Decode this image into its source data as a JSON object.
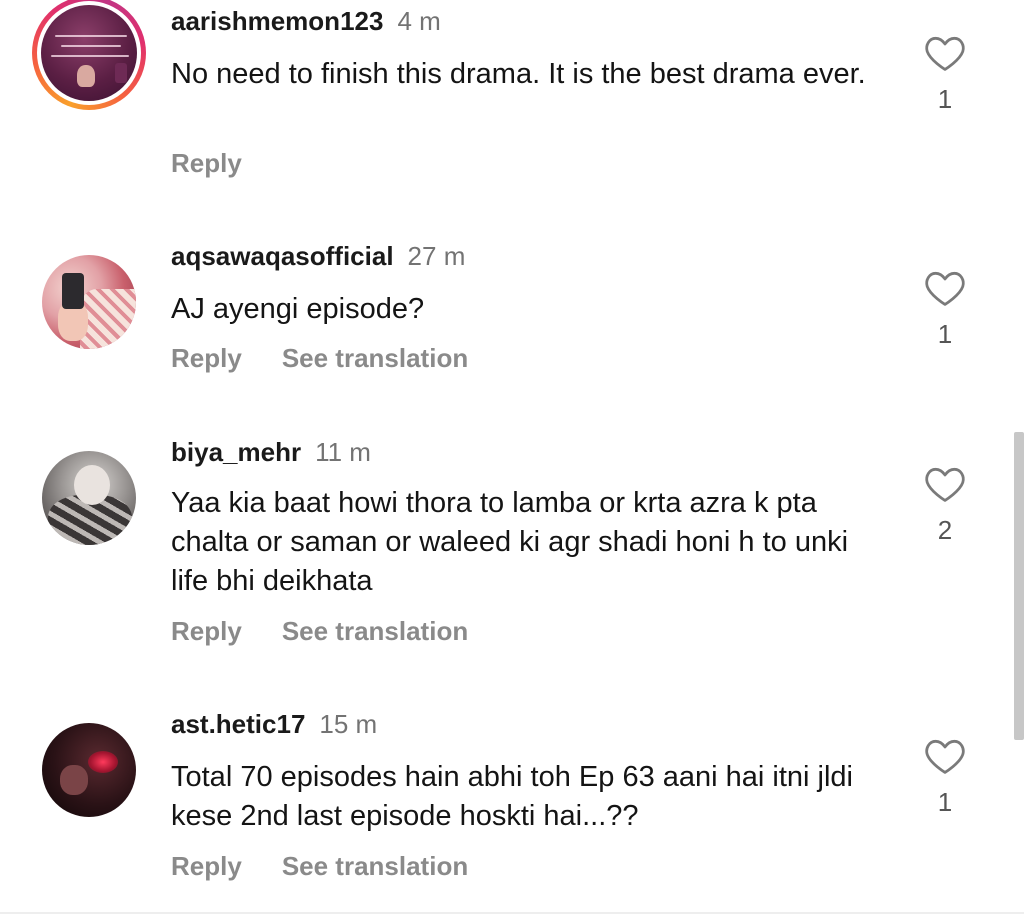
{
  "comments": [
    {
      "username": "aarishmemon123",
      "time": "4 m",
      "text": "No need to finish this drama. It is the best drama ever.",
      "reply_label": "Reply",
      "translate_label": "",
      "likes": "1"
    },
    {
      "username": "aqsawaqasofficial",
      "time": "27 m",
      "text": "AJ ayengi episode?",
      "reply_label": "Reply",
      "translate_label": "See translation",
      "likes": "1"
    },
    {
      "username": "biya_mehr",
      "time": "11 m",
      "text": "Yaa kia baat howi thora to lamba or krta azra k pta chalta or saman or waleed ki agr shadi honi h to unki life bhi deikhata",
      "reply_label": "Reply",
      "translate_label": "See translation",
      "likes": "2"
    },
    {
      "username": "ast.hetic17",
      "time": "15 m",
      "text": "Total 70 episodes hain abhi toh Ep 63 aani hai itni jldi kese 2nd last episode hoskti hai...??",
      "reply_label": "Reply",
      "translate_label": "See translation",
      "likes": "1"
    }
  ],
  "icons": {
    "like": "heart-outline-icon"
  },
  "colors": {
    "username": "#1a1a1a",
    "meta": "#737373",
    "action": "#8a8a8a",
    "story_ring_start": "#f9a02b",
    "story_ring_end": "#c13584"
  }
}
